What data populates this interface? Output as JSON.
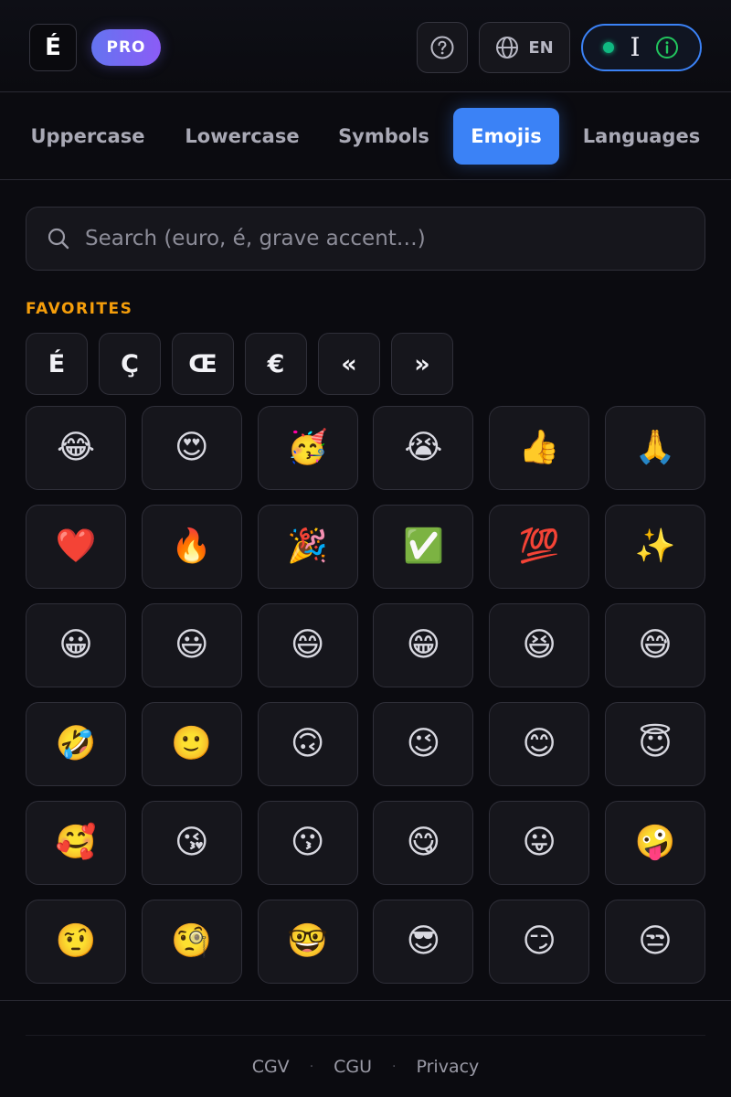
{
  "header": {
    "logo_text": "É",
    "pro_label": "PRO",
    "lang_label": "EN",
    "cursor_glyph": "I"
  },
  "tabs": [
    {
      "label": "Uppercase"
    },
    {
      "label": "Lowercase"
    },
    {
      "label": "Symbols"
    },
    {
      "label": "Emojis"
    },
    {
      "label": "Languages"
    }
  ],
  "active_tab": "Emojis",
  "search": {
    "placeholder": "Search (euro, é, grave accent…)",
    "value": ""
  },
  "favorites": {
    "title": "FAVORITES",
    "keys": [
      "É",
      "Ç",
      "Œ",
      "€",
      "«",
      "»"
    ]
  },
  "emojis": [
    "😂",
    "😍",
    "🥳",
    "😭",
    "👍",
    "🙏",
    "❤️",
    "🔥",
    "🎉",
    "✅",
    "💯",
    "✨",
    "😀",
    "😃",
    "😄",
    "😁",
    "😆",
    "😅",
    "🤣",
    "🙂",
    "🙃",
    "😉",
    "😊",
    "😇",
    "🥰",
    "😘",
    "😗",
    "😋",
    "😛",
    "🤪",
    "🤨",
    "🧐",
    "🤓",
    "😎",
    "😏",
    "😒"
  ],
  "footer": {
    "links": [
      "CGV",
      "CGU",
      "Privacy"
    ],
    "separator": "·"
  },
  "colors": {
    "accent": "#3b82f6",
    "favorites_title": "#f59e0b",
    "status_online": "#10b981",
    "info_icon": "#22c55e"
  }
}
